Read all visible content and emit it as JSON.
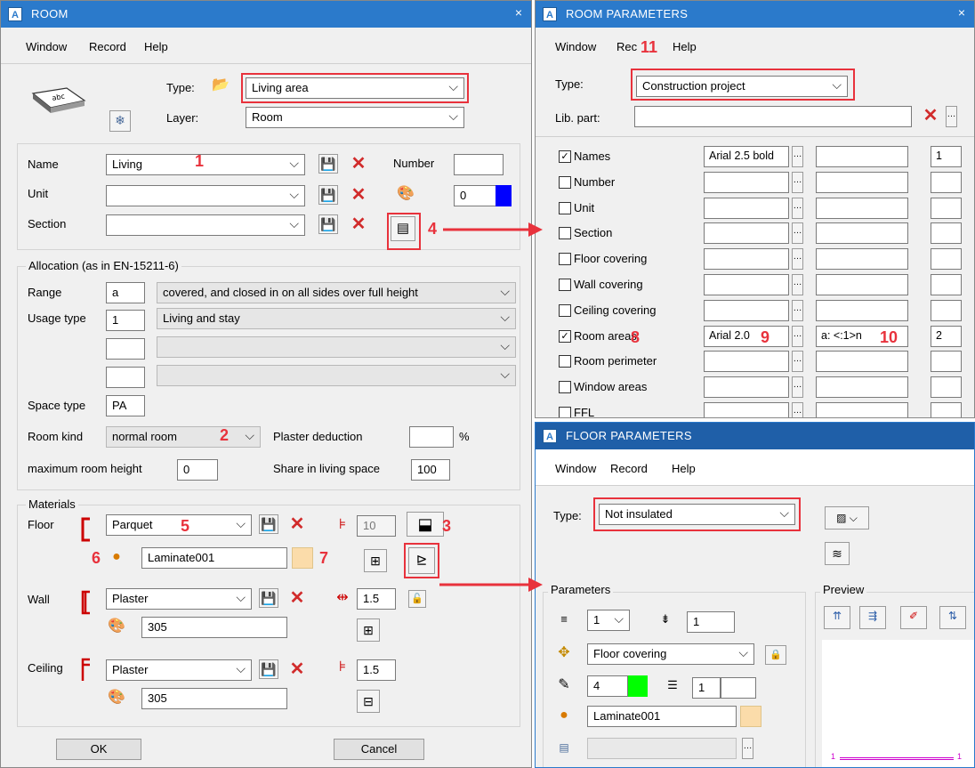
{
  "room": {
    "title": "ROOM",
    "app_icon": "A",
    "close": "×",
    "menu": [
      "Window",
      "Record",
      "Help"
    ],
    "type_label": "Type:",
    "type_value": "Living area",
    "layer_label": "Layer:",
    "layer_value": "Room",
    "name_label": "Name",
    "name_value": "Living",
    "unit_label": "Unit",
    "unit_value": "",
    "section_label": "Section",
    "section_value": "",
    "number_label": "Number",
    "number_value": "",
    "color_number": "0",
    "color_hex": "#0000ff",
    "allocation_label": "Allocation (as in EN-15211-6)",
    "range_label": "Range",
    "range_code": "a",
    "range_value": "covered, and closed in on all sides over full height",
    "usage_label": "Usage type",
    "usage_code": "1",
    "usage_value": "Living and stay",
    "space_type_label": "Space type",
    "space_type_value": "PA",
    "room_kind_label": "Room kind",
    "room_kind_value": "normal room",
    "plaster_label": "Plaster deduction",
    "plaster_value": "",
    "percent": "%",
    "max_height_label": "maximum room height",
    "max_height_value": "0",
    "share_label": "Share in living space",
    "share_value": "100",
    "materials_label": "Materials",
    "floor_label": "Floor",
    "floor_value": "Parquet",
    "floor_thickness": "10",
    "floor_surface": "Laminate001",
    "floor_swatch": "#fbdcaa",
    "wall_label": "Wall",
    "wall_value": "Plaster",
    "wall_thickness": "1.5",
    "wall_surface": "305",
    "ceiling_label": "Ceiling",
    "ceiling_value": "Plaster",
    "ceiling_thickness": "1.5",
    "ceiling_surface": "305",
    "ok": "OK",
    "cancel": "Cancel"
  },
  "room_params": {
    "title": "ROOM PARAMETERS",
    "app_icon": "A",
    "close": "×",
    "menu": [
      "Window",
      "Rec",
      "Help"
    ],
    "type_label": "Type:",
    "type_value": "Construction project",
    "lib_label": "Lib. part:",
    "lib_value": "",
    "rows": [
      {
        "label": "Names",
        "checked": "✓",
        "font": "Arial 2.5 bold",
        "format": "",
        "size": "1"
      },
      {
        "label": "Number",
        "checked": "",
        "font": "",
        "format": "",
        "size": ""
      },
      {
        "label": "Unit",
        "checked": "",
        "font": "",
        "format": "",
        "size": ""
      },
      {
        "label": "Section",
        "checked": "",
        "font": "",
        "format": "",
        "size": ""
      },
      {
        "label": "Floor covering",
        "checked": "",
        "font": "",
        "format": "",
        "size": ""
      },
      {
        "label": "Wall covering",
        "checked": "",
        "font": "",
        "format": "",
        "size": ""
      },
      {
        "label": "Ceiling covering",
        "checked": "",
        "font": "",
        "format": "",
        "size": ""
      },
      {
        "label": "Room areas",
        "checked": "✓",
        "font": "Arial 2.0",
        "format": "a: <:1>n",
        "size": "2"
      },
      {
        "label": "Room perimeter",
        "checked": "",
        "font": "",
        "format": "",
        "size": ""
      },
      {
        "label": "Window areas",
        "checked": "",
        "font": "",
        "format": "",
        "size": ""
      },
      {
        "label": "FFL",
        "checked": "",
        "font": "",
        "format": "",
        "size": ""
      }
    ]
  },
  "floor_params": {
    "title": "FLOOR PARAMETERS",
    "app_icon": "A",
    "menu": [
      "Window",
      "Record",
      "Help"
    ],
    "type_label": "Type:",
    "type_value": "Not insulated",
    "parameters_label": "Parameters",
    "preview_label": "Preview",
    "layer_count": "1",
    "layer_thickness": "1",
    "component_value": "Floor covering",
    "pen_value": "4",
    "pen_color": "#00ff00",
    "line_value": "1",
    "surface_value": "Laminate001",
    "surface_swatch": "#fbdcaa",
    "hatch_value": "",
    "preview_dim": "1"
  },
  "callouts": [
    "1",
    "2",
    "3",
    "4",
    "5",
    "6",
    "7",
    "8",
    "9",
    "10",
    "11"
  ],
  "accent": "#e8323c",
  "titlebar_color": "#2b7acb"
}
